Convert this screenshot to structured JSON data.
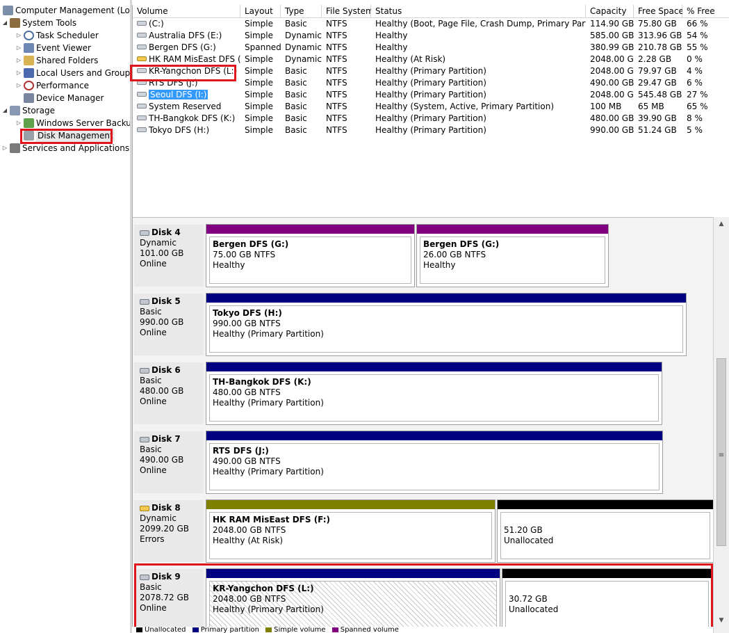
{
  "tree": {
    "root": "Computer Management (Local",
    "system_tools": "System Tools",
    "task_scheduler": "Task Scheduler",
    "event_viewer": "Event Viewer",
    "shared_folders": "Shared Folders",
    "local_users": "Local Users and Groups",
    "performance": "Performance",
    "device_manager": "Device Manager",
    "storage": "Storage",
    "windows_server_backup": "Windows Server Backup",
    "disk_management": "Disk Management",
    "services_apps": "Services and Applications"
  },
  "volume_list": {
    "headers": [
      "Volume",
      "Layout",
      "Type",
      "File System",
      "Status",
      "Capacity",
      "Free Space",
      "% Free"
    ],
    "rows": [
      {
        "name": "(C:)",
        "layout": "Simple",
        "type": "Basic",
        "fs": "NTFS",
        "status": "Healthy (Boot, Page File, Crash Dump, Primary Partition)",
        "capacity": "114.90 GB",
        "free": "75.80 GB",
        "pct": "66 %"
      },
      {
        "name": "Australia DFS (E:)",
        "layout": "Simple",
        "type": "Dynamic",
        "fs": "NTFS",
        "status": "Healthy",
        "capacity": "585.00 GB",
        "free": "313.96 GB",
        "pct": "54 %"
      },
      {
        "name": "Bergen DFS (G:)",
        "layout": "Spanned",
        "type": "Dynamic",
        "fs": "NTFS",
        "status": "Healthy",
        "capacity": "380.99 GB",
        "free": "210.78 GB",
        "pct": "55 %"
      },
      {
        "name": "HK RAM MisEast DFS (F:)",
        "layout": "Simple",
        "type": "Dynamic",
        "fs": "NTFS",
        "status": "Healthy (At Risk)",
        "capacity": "2048.00 GB",
        "free": "2.28 GB",
        "pct": "0 %"
      },
      {
        "name": "KR-Yangchon DFS (L:)",
        "layout": "Simple",
        "type": "Basic",
        "fs": "NTFS",
        "status": "Healthy (Primary Partition)",
        "capacity": "2048.00 GB",
        "free": "79.97 GB",
        "pct": "4 %"
      },
      {
        "name": "RTS DFS (J:)",
        "layout": "Simple",
        "type": "Basic",
        "fs": "NTFS",
        "status": "Healthy (Primary Partition)",
        "capacity": "490.00 GB",
        "free": "29.47 GB",
        "pct": "6 %"
      },
      {
        "name": "Seoul DFS (I:)",
        "layout": "Simple",
        "type": "Basic",
        "fs": "NTFS",
        "status": "Healthy (Primary Partition)",
        "capacity": "2048.00 GB",
        "free": "545.48 GB",
        "pct": "27 %"
      },
      {
        "name": "System Reserved",
        "layout": "Simple",
        "type": "Basic",
        "fs": "NTFS",
        "status": "Healthy (System, Active, Primary Partition)",
        "capacity": "100 MB",
        "free": "65 MB",
        "pct": "65 %"
      },
      {
        "name": "TH-Bangkok DFS (K:)",
        "layout": "Simple",
        "type": "Basic",
        "fs": "NTFS",
        "status": "Healthy (Primary Partition)",
        "capacity": "480.00 GB",
        "free": "39.90 GB",
        "pct": "8 %"
      },
      {
        "name": "Tokyo DFS (H:)",
        "layout": "Simple",
        "type": "Basic",
        "fs": "NTFS",
        "status": "Healthy (Primary Partition)",
        "capacity": "990.00 GB",
        "free": "51.24 GB",
        "pct": "5 %"
      }
    ]
  },
  "disks": [
    {
      "name": "Disk 4",
      "type": "Dynamic",
      "size": "101.00 GB",
      "state": "Online",
      "partitions": [
        {
          "name": "Bergen DFS  (G:)",
          "size": "75.00 GB NTFS",
          "status": "Healthy"
        },
        {
          "name": "Bergen DFS  (G:)",
          "size": "26.00 GB NTFS",
          "status": "Healthy"
        }
      ]
    },
    {
      "name": "Disk 5",
      "type": "Basic",
      "size": "990.00 GB",
      "state": "Online",
      "partitions": [
        {
          "name": "Tokyo DFS  (H:)",
          "size": "990.00 GB NTFS",
          "status": "Healthy (Primary Partition)"
        }
      ]
    },
    {
      "name": "Disk 6",
      "type": "Basic",
      "size": "480.00 GB",
      "state": "Online",
      "partitions": [
        {
          "name": "TH-Bangkok DFS  (K:)",
          "size": "480.00 GB NTFS",
          "status": "Healthy (Primary Partition)"
        }
      ]
    },
    {
      "name": "Disk 7",
      "type": "Basic",
      "size": "490.00 GB",
      "state": "Online",
      "partitions": [
        {
          "name": "RTS DFS  (J:)",
          "size": "490.00 GB NTFS",
          "status": "Healthy (Primary Partition)"
        }
      ]
    },
    {
      "name": "Disk 8",
      "type": "Dynamic",
      "size": "2099.20 GB",
      "state": "Errors",
      "partitions": [
        {
          "name": "HK RAM MisEast DFS  (F:)",
          "size": "2048.00 GB NTFS",
          "status": "Healthy (At Risk)"
        },
        {
          "size": "51.20 GB",
          "status": "Unallocated"
        }
      ]
    },
    {
      "name": "Disk 9",
      "type": "Basic",
      "size": "2078.72 GB",
      "state": "Online",
      "partitions": [
        {
          "name": "KR-Yangchon DFS  (L:)",
          "size": "2048.00 GB NTFS",
          "status": "Healthy (Primary Partition)"
        },
        {
          "size": "30.72 GB",
          "status": "Unallocated"
        }
      ]
    }
  ],
  "legend": [
    {
      "label": "Unallocated",
      "color": "#000000"
    },
    {
      "label": "Primary partition",
      "color": "#000080"
    },
    {
      "label": "Simple volume",
      "color": "#808000"
    },
    {
      "label": "Spanned volume",
      "color": "#800080"
    }
  ],
  "colors": {
    "spanned": "#800080",
    "primary": "#000080",
    "simple": "#808000",
    "unallocated": "#000000",
    "highlight": "#e0141b",
    "selection": "#3399ff"
  }
}
